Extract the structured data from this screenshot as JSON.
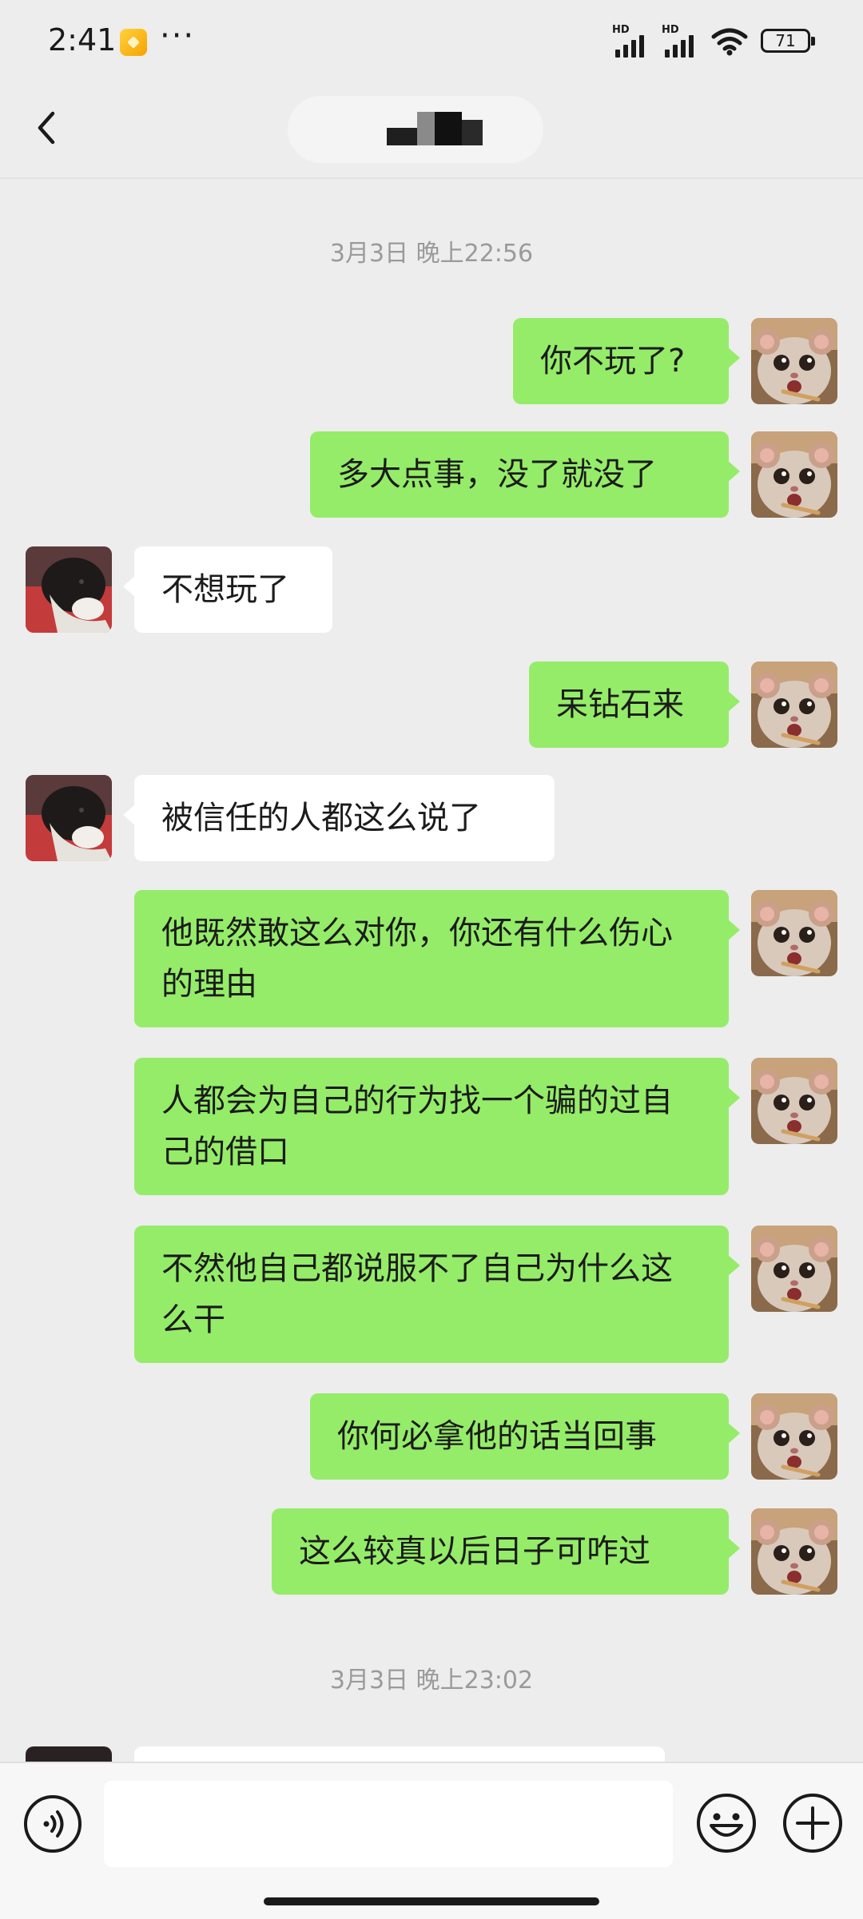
{
  "status_bar": {
    "time": "2:41",
    "more": "···",
    "battery": "71",
    "hd": "HD"
  },
  "header": {
    "title": ""
  },
  "colors": {
    "sent_bubble": "#95ec69",
    "received_bubble": "#ffffff",
    "background": "#ededed"
  },
  "chat": {
    "timestamp1": "3月3日 晚上22:56",
    "m1": "你不玩了?",
    "m2": "多大点事，没了就没了",
    "m3": "不想玩了",
    "m4": "呆钻石来",
    "m5": "被信任的人都这么说了",
    "m6": "他既然敢这么对你，你还有什么伤心的理由",
    "m7": "人都会为自己的行为找一个骗的过自己的借口",
    "m8": "不然他自己都说服不了自己为什么这么干",
    "m9": "你何必拿他的话当回事",
    "m10": "这么较真以后日子可咋过",
    "timestamp2": "3月3日 晚上23:02"
  },
  "input": {
    "value": ""
  },
  "icons": {
    "back": "back-arrow-icon",
    "voice": "voice-icon",
    "emoji": "emoji-icon",
    "plus": "plus-icon"
  }
}
